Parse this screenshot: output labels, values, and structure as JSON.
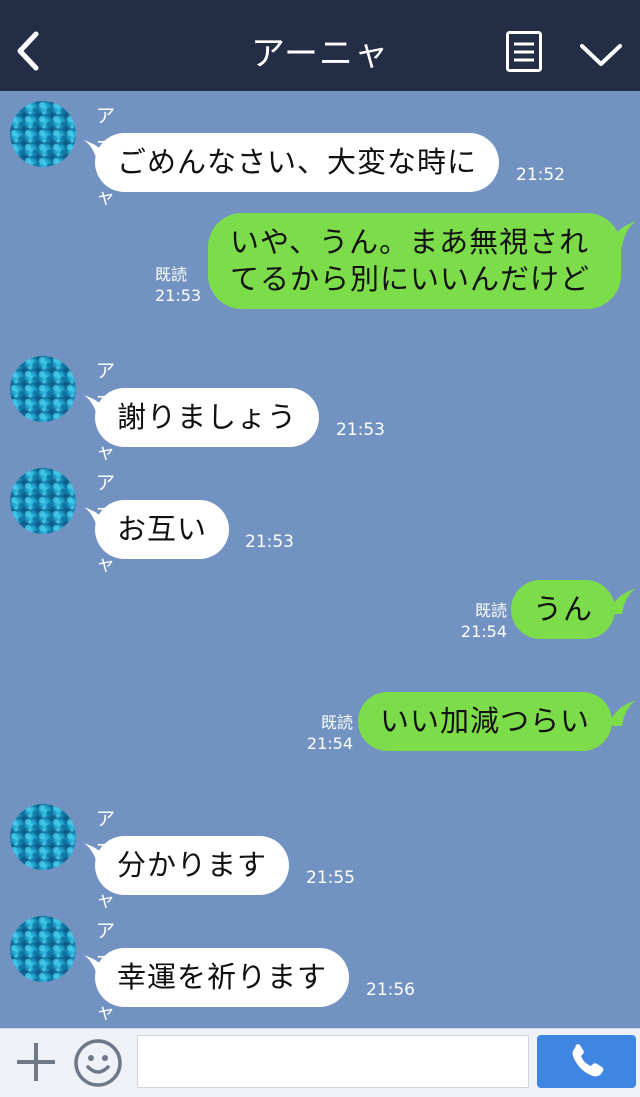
{
  "header": {
    "title": "アーニャ",
    "back_icon": "chevron-left-icon",
    "menu_icon": "menu-icon",
    "collapse_icon": "chevron-down-icon"
  },
  "messages": [
    {
      "direction": "in",
      "sender": "アーニャ",
      "text": "ごめんなさい、大変な時に",
      "time": "21:52"
    },
    {
      "direction": "out",
      "lines": [
        "いや、うん。まあ無視され",
        "てるから別にいいんだけど"
      ],
      "read": "既読",
      "time": "21:53"
    },
    {
      "direction": "in",
      "sender": "アーニャ",
      "text": "謝りましょう",
      "time": "21:53"
    },
    {
      "direction": "in",
      "sender": "アーニャ",
      "text": "お互い",
      "time": "21:53"
    },
    {
      "direction": "out",
      "text": "うん",
      "read": "既読",
      "time": "21:54"
    },
    {
      "direction": "out",
      "text": "いい加減つらい",
      "read": "既読",
      "time": "21:54"
    },
    {
      "direction": "in",
      "sender": "アーニャ",
      "text": "分かります",
      "time": "21:55"
    },
    {
      "direction": "in",
      "sender": "アーニャ",
      "text": "幸運を祈ります",
      "time": "21:56"
    }
  ],
  "footer": {
    "input_value": "",
    "plus_icon": "plus-icon",
    "emoji_icon": "smiley-icon",
    "call_icon": "phone-icon"
  },
  "colors": {
    "header_bg": "#232d45",
    "chat_bg": "#7293c1",
    "incoming_bubble": "#ffffff",
    "outgoing_bubble": "#7ddc4a",
    "call_button": "#3f86e3"
  }
}
